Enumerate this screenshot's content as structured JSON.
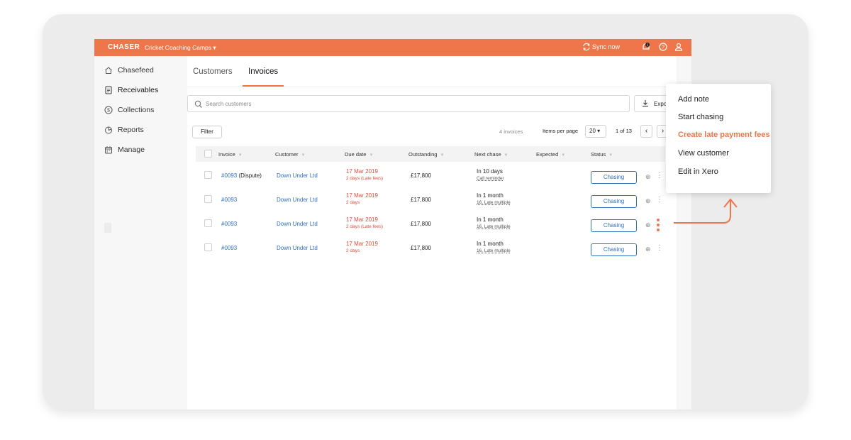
{
  "topbar": {
    "brand": "CHASER",
    "org": "Cricket Coaching Camps ▾",
    "sync": "Sync now",
    "notification_count": "1",
    "color": "#ee764a"
  },
  "sidebar": {
    "items": [
      {
        "label": "Chasefeed",
        "icon": "home-icon"
      },
      {
        "label": "Receivables",
        "icon": "document-icon"
      },
      {
        "label": "Collections",
        "icon": "dollar-circle-icon"
      },
      {
        "label": "Reports",
        "icon": "pie-chart-icon"
      },
      {
        "label": "Manage",
        "icon": "calendar-icon"
      }
    ]
  },
  "tabs": {
    "customers": "Customers",
    "invoices": "Invoices"
  },
  "search": {
    "placeholder": "Search customers"
  },
  "export": {
    "label": "Expo"
  },
  "toolbar": {
    "filter": "Filter",
    "count": "4 invoices",
    "items_per_page": "Items per page",
    "page_size": "20 ▾",
    "pagination": "1 of 13",
    "prev": "‹",
    "next": "›"
  },
  "table": {
    "headers": {
      "invoice": "Invoice",
      "customer": "Customer",
      "due_date": "Due date",
      "outstanding": "Outstanding",
      "next_chase": "Next chase",
      "expected": "Expected",
      "status": "Status"
    },
    "rows": [
      {
        "invoice": "#0093",
        "invoice_note": " (Dispute)",
        "customer": "Down Under Ltd",
        "due_date": "17 Mar 2019",
        "due_sub": "2 days (Late fees)",
        "outstanding": "£17,800",
        "next_chase": "In 10 days",
        "next_sub": "Call reminder",
        "status": "Chasing"
      },
      {
        "invoice": "#0093",
        "invoice_note": "",
        "customer": "Down Under Ltd",
        "due_date": "17 Mar 2019",
        "due_sub": "2 days",
        "outstanding": "£17,800",
        "next_chase": "In 1 month",
        "next_sub": "16. Late multiple",
        "status": "Chasing"
      },
      {
        "invoice": "#0093",
        "invoice_note": "",
        "customer": "Down Under Ltd",
        "due_date": "17 Mar 2019",
        "due_sub": "2 days (Late fees)",
        "outstanding": "£17,800",
        "next_chase": "In 1 month",
        "next_sub": "16. Late multiple",
        "status": "Chasing"
      },
      {
        "invoice": "#0093",
        "invoice_note": "",
        "customer": "Down Under Ltd",
        "due_date": "17 Mar 2019",
        "due_sub": "2 days",
        "outstanding": "£17,800",
        "next_chase": "In 1 month",
        "next_sub": "16. Late multiple",
        "status": "Chasing"
      }
    ]
  },
  "context_menu": {
    "items": [
      {
        "label": "Add note"
      },
      {
        "label": "Start chasing"
      },
      {
        "label": "Create late payment fees"
      },
      {
        "label": "View customer"
      },
      {
        "label": "Edit in Xero"
      }
    ],
    "active_color": "#ee764a"
  }
}
